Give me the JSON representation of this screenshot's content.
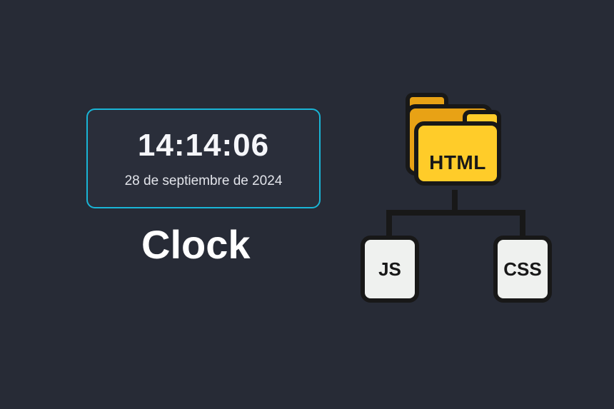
{
  "clock": {
    "time": "14:14:06",
    "date": "28 de septiembre de 2024"
  },
  "title": "Clock",
  "diagram": {
    "folder_label": "HTML",
    "file_js_label": "JS",
    "file_css_label": "CSS"
  }
}
